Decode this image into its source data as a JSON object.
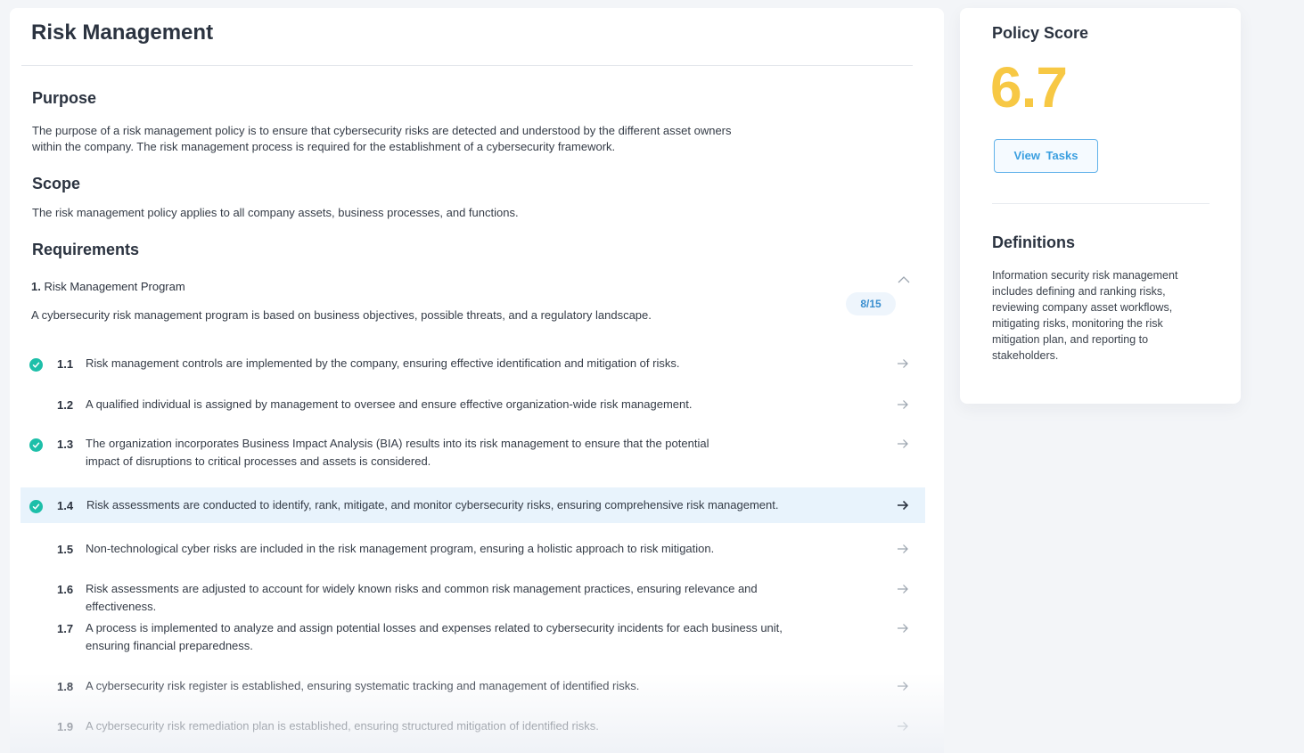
{
  "page": {
    "title": "Risk Management"
  },
  "purpose": {
    "heading": "Purpose",
    "text_line1": "The purpose of a risk management policy is to ensure that cybersecurity risks are detected and understood by the different asset owners",
    "text_line2": "within the company. The risk management process is required for the establishment of a cybersecurity framework."
  },
  "scope": {
    "heading": "Scope",
    "text": "The risk management policy applies to all company assets, business processes, and functions."
  },
  "requirements": {
    "heading": "Requirements",
    "group_number": "1.",
    "group_title": "Risk Management Program",
    "group_description": "A cybersecurity risk management program is based on business objectives, possible threats, and a regulatory landscape.",
    "progress": "8/15",
    "items": [
      {
        "num": "1.1",
        "line1": "Risk management controls are implemented by the company, ensuring effective identification and mitigation of risks.",
        "line2": "",
        "completed": true,
        "selected": false
      },
      {
        "num": "1.2",
        "line1": "A qualified individual is assigned by management to oversee and ensure effective organization-wide risk management.",
        "line2": "",
        "completed": false,
        "selected": false
      },
      {
        "num": "1.3",
        "line1": "The organization incorporates Business Impact Analysis (BIA) results into its risk management to ensure that the potential",
        "line2": "impact of disruptions to critical processes and assets is considered.",
        "completed": true,
        "selected": false
      },
      {
        "num": "1.4",
        "line1": "Risk assessments are conducted to identify, rank, mitigate, and monitor cybersecurity risks, ensuring comprehensive risk management.",
        "line2": "",
        "completed": true,
        "selected": true
      },
      {
        "num": "1.5",
        "line1": "Non-technological cyber risks are included in the risk management program, ensuring a holistic approach to risk mitigation.",
        "line2": "",
        "completed": false,
        "selected": false
      },
      {
        "num": "1.6",
        "line1": "Risk assessments are adjusted to account for widely known risks and common risk management practices, ensuring relevance and effectiveness.",
        "line2": "",
        "completed": false,
        "selected": false
      },
      {
        "num": "1.7",
        "line1": "A process is implemented to analyze and assign potential losses and expenses related to cybersecurity incidents for each business unit,",
        "line2": "ensuring financial preparedness.",
        "completed": false,
        "selected": false
      },
      {
        "num": "1.8",
        "line1": "A cybersecurity risk register is established, ensuring systematic tracking and management of identified risks.",
        "line2": "",
        "completed": false,
        "selected": false
      },
      {
        "num": "1.9",
        "line1": "A cybersecurity risk remediation plan is established, ensuring structured mitigation of identified risks.",
        "line2": "",
        "completed": false,
        "selected": false
      }
    ]
  },
  "policy_score": {
    "heading": "Policy Score",
    "value": "6.7",
    "value_color": "#f7c844",
    "button_label": "View Tasks"
  },
  "definitions": {
    "heading": "Definitions",
    "lines": [
      "Information security risk management",
      "includes defining and ranking risks,",
      "reviewing company asset workflows,",
      "mitigating risks, monitoring the risk",
      "mitigation plan, and reporting to",
      "stakeholders."
    ]
  },
  "colors": {
    "accent": "#3b9fe0",
    "check": "#1dbfa9",
    "highlight": "#e8f3fc"
  }
}
